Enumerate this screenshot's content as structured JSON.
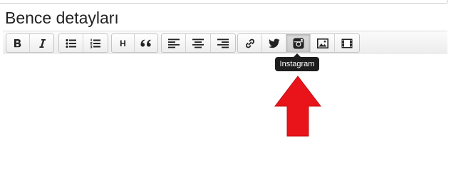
{
  "field": {
    "title": "Bence detayları"
  },
  "toolbar": {
    "heading_label": "H",
    "tooltip": "Instagram",
    "buttons": [
      {
        "name": "bold-button",
        "icon": "bold-icon"
      },
      {
        "name": "italic-button",
        "icon": "italic-icon"
      },
      {
        "name": "bulleted-list-button",
        "icon": "bulleted-list-icon"
      },
      {
        "name": "numbered-list-button",
        "icon": "numbered-list-icon"
      },
      {
        "name": "heading-button",
        "icon": "heading-icon"
      },
      {
        "name": "quote-button",
        "icon": "quote-icon"
      },
      {
        "name": "align-left-button",
        "icon": "align-left-icon"
      },
      {
        "name": "align-center-button",
        "icon": "align-center-icon"
      },
      {
        "name": "align-right-button",
        "icon": "align-right-icon"
      },
      {
        "name": "link-button",
        "icon": "link-icon"
      },
      {
        "name": "twitter-button",
        "icon": "twitter-icon"
      },
      {
        "name": "instagram-button",
        "icon": "instagram-icon",
        "state": "active"
      },
      {
        "name": "image-button",
        "icon": "image-icon"
      },
      {
        "name": "video-button",
        "icon": "video-icon"
      }
    ]
  },
  "annotation": {
    "icon": "up-arrow-icon",
    "color": "#e8141a"
  },
  "colors": {
    "toolbar_border": "#c4c4c4",
    "tooltip_bg": "#1d1d1d",
    "text": "#222222"
  }
}
